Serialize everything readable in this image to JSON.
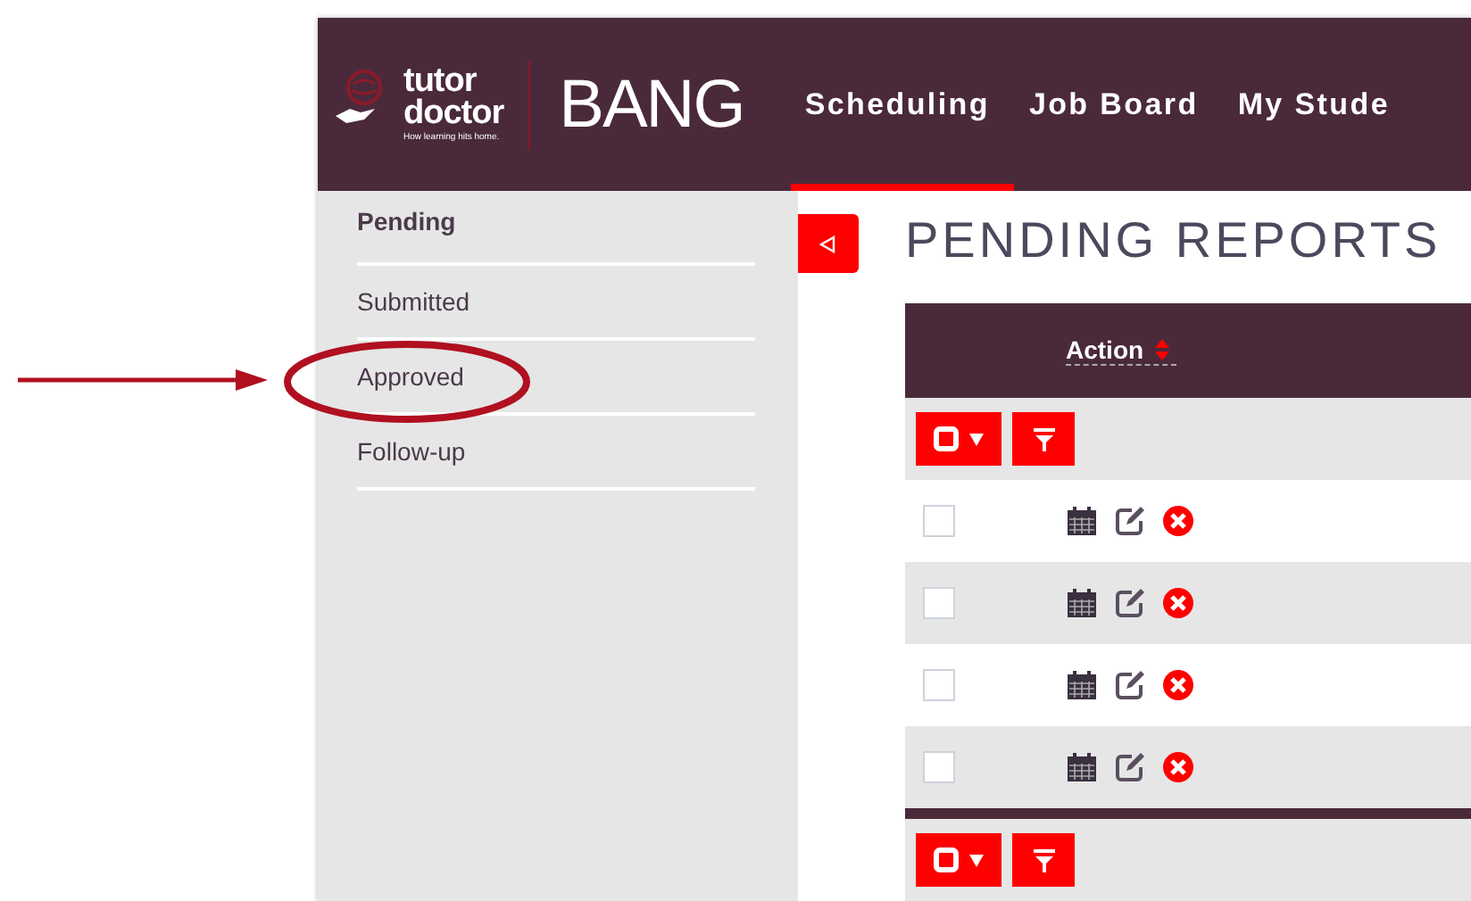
{
  "header": {
    "logo": {
      "brand_top": "tutor",
      "brand_bottom": "doctor",
      "tagline": "How learning hits home."
    },
    "app_name": "BANG",
    "nav": [
      {
        "label": "Scheduling",
        "selected": true
      },
      {
        "label": "Job Board",
        "selected": false
      },
      {
        "label": "My Stude",
        "selected": false
      }
    ]
  },
  "sidebar": {
    "items": [
      {
        "label": "Pending",
        "selected": true,
        "circled": false
      },
      {
        "label": "Submitted",
        "selected": false,
        "circled": false
      },
      {
        "label": "Approved",
        "selected": false,
        "circled": true
      },
      {
        "label": "Follow-up",
        "selected": false,
        "circled": false
      }
    ]
  },
  "page": {
    "title": "PENDING REPORTS"
  },
  "table": {
    "columns": [
      {
        "label": "Action"
      }
    ],
    "rows": [
      {
        "checked": false
      },
      {
        "checked": false
      },
      {
        "checked": false
      },
      {
        "checked": false
      }
    ]
  }
}
